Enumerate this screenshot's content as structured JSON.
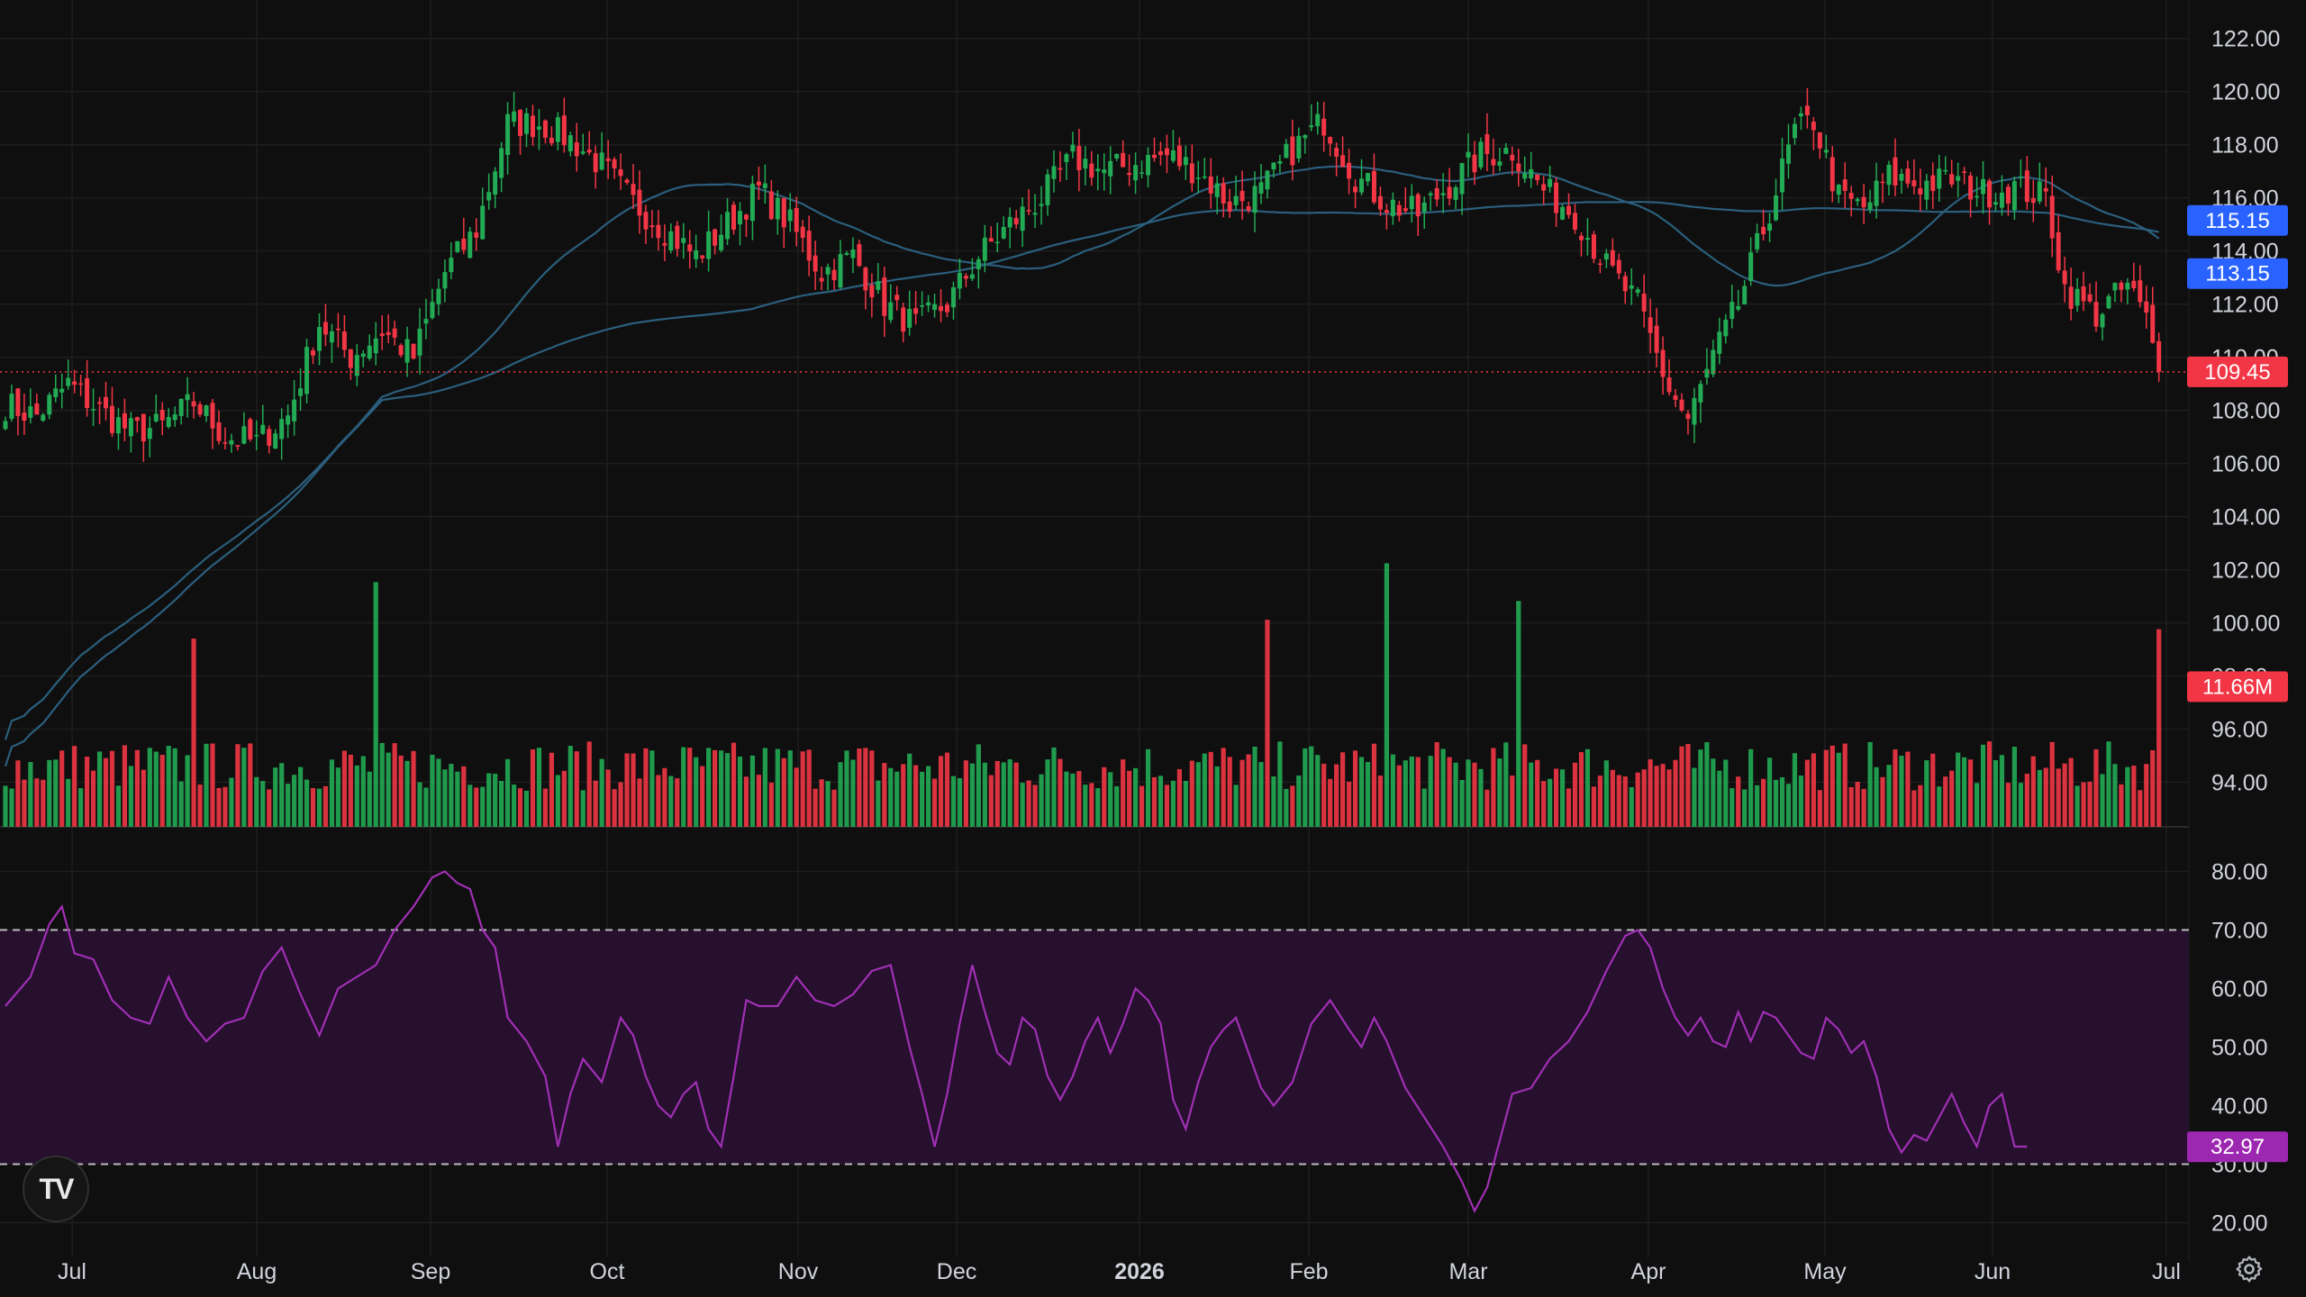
{
  "colors": {
    "background": "#0f0f0f",
    "grid": "#1e1e1e",
    "up": "#22ab54",
    "down": "#f23645",
    "ma": "#2b5f7d",
    "rsi_line": "#a12fb4",
    "rsi_band": "#26102e",
    "badge_price": "#f23645",
    "badge_ma": "#2962ff",
    "badge_rsi": "#9c27b0"
  },
  "chart_data": [
    {
      "type": "candlestick",
      "title": "",
      "price_axis": {
        "min": 93,
        "max": 122.5,
        "ticks": [
          "122.00",
          "120.00",
          "118.00",
          "116.00",
          "114.00",
          "112.00",
          "110.00",
          "108.00",
          "106.00",
          "104.00",
          "102.00",
          "100.00",
          "98.00",
          "96.00",
          "94.00"
        ]
      },
      "time_axis_labels": [
        "Jul",
        "Aug",
        "Sep",
        "Oct",
        "Nov",
        "Dec",
        "2026",
        "Feb",
        "Mar",
        "Apr",
        "May",
        "Jun",
        "Jul"
      ],
      "grid": true,
      "last_price": 109.45,
      "moving_averages": [
        {
          "value": 115.15,
          "color": "#2b5f7d"
        },
        {
          "value": 113.15,
          "color": "#2b5f7d"
        }
      ],
      "ohlc_anchors": {
        "format": "[trading_day_index, close]",
        "points": [
          [
            0,
            108.2
          ],
          [
            5,
            107.8
          ],
          [
            10,
            109.0
          ],
          [
            15,
            108.0
          ],
          [
            20,
            107.2
          ],
          [
            25,
            107.4
          ],
          [
            30,
            108.3
          ],
          [
            35,
            107.0
          ],
          [
            40,
            106.8
          ],
          [
            45,
            107.8
          ],
          [
            50,
            111.3
          ],
          [
            55,
            110.0
          ],
          [
            60,
            111.0
          ],
          [
            65,
            110.0
          ],
          [
            70,
            113.2
          ],
          [
            75,
            114.8
          ],
          [
            80,
            118.8
          ],
          [
            85,
            118.8
          ],
          [
            90,
            118.2
          ],
          [
            95,
            117.2
          ],
          [
            100,
            115.8
          ],
          [
            105,
            114.8
          ],
          [
            110,
            113.8
          ],
          [
            115,
            115.0
          ],
          [
            120,
            116.3
          ],
          [
            125,
            115.0
          ],
          [
            130,
            113.2
          ],
          [
            135,
            113.8
          ],
          [
            140,
            112.0
          ],
          [
            145,
            111.2
          ],
          [
            150,
            112.0
          ],
          [
            155,
            113.8
          ],
          [
            160,
            115.0
          ],
          [
            165,
            116.0
          ],
          [
            170,
            117.5
          ],
          [
            175,
            117.0
          ],
          [
            180,
            117.3
          ],
          [
            185,
            117.6
          ],
          [
            190,
            117.0
          ],
          [
            195,
            115.8
          ],
          [
            200,
            116.2
          ],
          [
            205,
            117.8
          ],
          [
            210,
            118.9
          ],
          [
            215,
            116.8
          ],
          [
            220,
            115.8
          ],
          [
            225,
            115.4
          ],
          [
            230,
            116.5
          ],
          [
            235,
            117.6
          ],
          [
            240,
            117.8
          ],
          [
            245,
            116.3
          ],
          [
            250,
            115.4
          ],
          [
            255,
            113.4
          ],
          [
            260,
            112.0
          ],
          [
            265,
            108.8
          ],
          [
            268,
            107.6
          ],
          [
            272,
            110.0
          ],
          [
            276,
            112.0
          ],
          [
            280,
            114.8
          ],
          [
            285,
            118.5
          ],
          [
            288,
            118.9
          ],
          [
            292,
            116.0
          ],
          [
            296,
            115.6
          ],
          [
            300,
            116.8
          ],
          [
            305,
            116.5
          ],
          [
            310,
            116.7
          ],
          [
            315,
            116.2
          ],
          [
            320,
            116.4
          ],
          [
            325,
            116.0
          ],
          [
            328,
            112.6
          ],
          [
            333,
            111.6
          ],
          [
            338,
            112.7
          ],
          [
            341,
            111.4
          ],
          [
            343,
            109.45
          ]
        ]
      },
      "volume": {
        "last_value_label": "11.66M",
        "spikes": [
          {
            "day": 30,
            "relative": 1.0,
            "direction": "down"
          },
          {
            "day": 59,
            "relative": 1.3,
            "direction": "up"
          },
          {
            "day": 201,
            "relative": 1.1,
            "direction": "down"
          },
          {
            "day": 220,
            "relative": 1.4,
            "direction": "up"
          },
          {
            "day": 241,
            "relative": 1.2,
            "direction": "up"
          },
          {
            "day": 343,
            "relative": 1.05,
            "direction": "down"
          }
        ]
      }
    },
    {
      "type": "line",
      "title": "",
      "y_axis": {
        "min": 15,
        "max": 85,
        "ticks": [
          "80.00",
          "70.00",
          "60.00",
          "50.00",
          "40.00",
          "30.00",
          "20.00"
        ]
      },
      "overbought": 70,
      "oversold": 30,
      "last_value": 32.97,
      "points": [
        [
          0,
          57
        ],
        [
          4,
          62
        ],
        [
          7,
          71
        ],
        [
          9,
          74
        ],
        [
          11,
          66
        ],
        [
          14,
          65
        ],
        [
          17,
          58
        ],
        [
          20,
          55
        ],
        [
          23,
          54
        ],
        [
          26,
          62
        ],
        [
          29,
          55
        ],
        [
          32,
          51
        ],
        [
          35,
          54
        ],
        [
          38,
          55
        ],
        [
          41,
          63
        ],
        [
          44,
          67
        ],
        [
          47,
          59
        ],
        [
          50,
          52
        ],
        [
          53,
          60
        ],
        [
          56,
          62
        ],
        [
          59,
          64
        ],
        [
          62,
          70
        ],
        [
          65,
          74
        ],
        [
          68,
          79
        ],
        [
          70,
          80
        ],
        [
          72,
          78
        ],
        [
          74,
          77
        ],
        [
          76,
          70
        ],
        [
          78,
          67
        ],
        [
          80,
          55
        ],
        [
          83,
          51
        ],
        [
          86,
          45
        ],
        [
          88,
          33
        ],
        [
          90,
          42
        ],
        [
          92,
          48
        ],
        [
          95,
          44
        ],
        [
          98,
          55
        ],
        [
          100,
          52
        ],
        [
          102,
          45
        ],
        [
          104,
          40
        ],
        [
          106,
          38
        ],
        [
          108,
          42
        ],
        [
          110,
          44
        ],
        [
          112,
          36
        ],
        [
          114,
          33
        ],
        [
          116,
          45
        ],
        [
          118,
          58
        ],
        [
          120,
          57
        ],
        [
          123,
          57
        ],
        [
          126,
          62
        ],
        [
          129,
          58
        ],
        [
          132,
          57
        ],
        [
          135,
          59
        ],
        [
          138,
          63
        ],
        [
          141,
          64
        ],
        [
          144,
          50
        ],
        [
          146,
          42
        ],
        [
          148,
          33
        ],
        [
          150,
          42
        ],
        [
          152,
          54
        ],
        [
          154,
          64
        ],
        [
          156,
          56
        ],
        [
          158,
          49
        ],
        [
          160,
          47
        ],
        [
          162,
          55
        ],
        [
          164,
          53
        ],
        [
          166,
          45
        ],
        [
          168,
          41
        ],
        [
          170,
          45
        ],
        [
          172,
          51
        ],
        [
          174,
          55
        ],
        [
          176,
          49
        ],
        [
          178,
          54
        ],
        [
          180,
          60
        ],
        [
          182,
          58
        ],
        [
          184,
          54
        ],
        [
          186,
          41
        ],
        [
          188,
          36
        ],
        [
          190,
          44
        ],
        [
          192,
          50
        ],
        [
          194,
          53
        ],
        [
          196,
          55
        ],
        [
          198,
          49
        ],
        [
          200,
          43
        ],
        [
          202,
          40
        ],
        [
          205,
          44
        ],
        [
          208,
          54
        ],
        [
          211,
          58
        ],
        [
          214,
          53
        ],
        [
          216,
          50
        ],
        [
          218,
          55
        ],
        [
          220,
          51
        ],
        [
          223,
          43
        ],
        [
          226,
          38
        ],
        [
          229,
          33
        ],
        [
          232,
          27
        ],
        [
          234,
          22
        ],
        [
          236,
          26
        ],
        [
          238,
          34
        ],
        [
          240,
          42
        ],
        [
          243,
          43
        ],
        [
          246,
          48
        ],
        [
          249,
          51
        ],
        [
          252,
          56
        ],
        [
          255,
          63
        ],
        [
          258,
          69
        ],
        [
          260,
          70
        ],
        [
          262,
          67
        ],
        [
          264,
          60
        ],
        [
          266,
          55
        ],
        [
          268,
          52
        ],
        [
          270,
          55
        ],
        [
          272,
          51
        ],
        [
          274,
          50
        ],
        [
          276,
          56
        ],
        [
          278,
          51
        ],
        [
          280,
          56
        ],
        [
          282,
          55
        ],
        [
          284,
          52
        ],
        [
          286,
          49
        ],
        [
          288,
          48
        ],
        [
          290,
          55
        ],
        [
          292,
          53
        ],
        [
          294,
          49
        ],
        [
          296,
          51
        ],
        [
          298,
          45
        ],
        [
          300,
          36
        ],
        [
          302,
          32
        ],
        [
          304,
          35
        ],
        [
          306,
          34
        ],
        [
          308,
          38
        ],
        [
          310,
          42
        ],
        [
          312,
          37
        ],
        [
          314,
          33
        ],
        [
          316,
          40
        ],
        [
          318,
          42
        ],
        [
          320,
          33
        ],
        [
          322,
          33
        ]
      ]
    }
  ]
}
